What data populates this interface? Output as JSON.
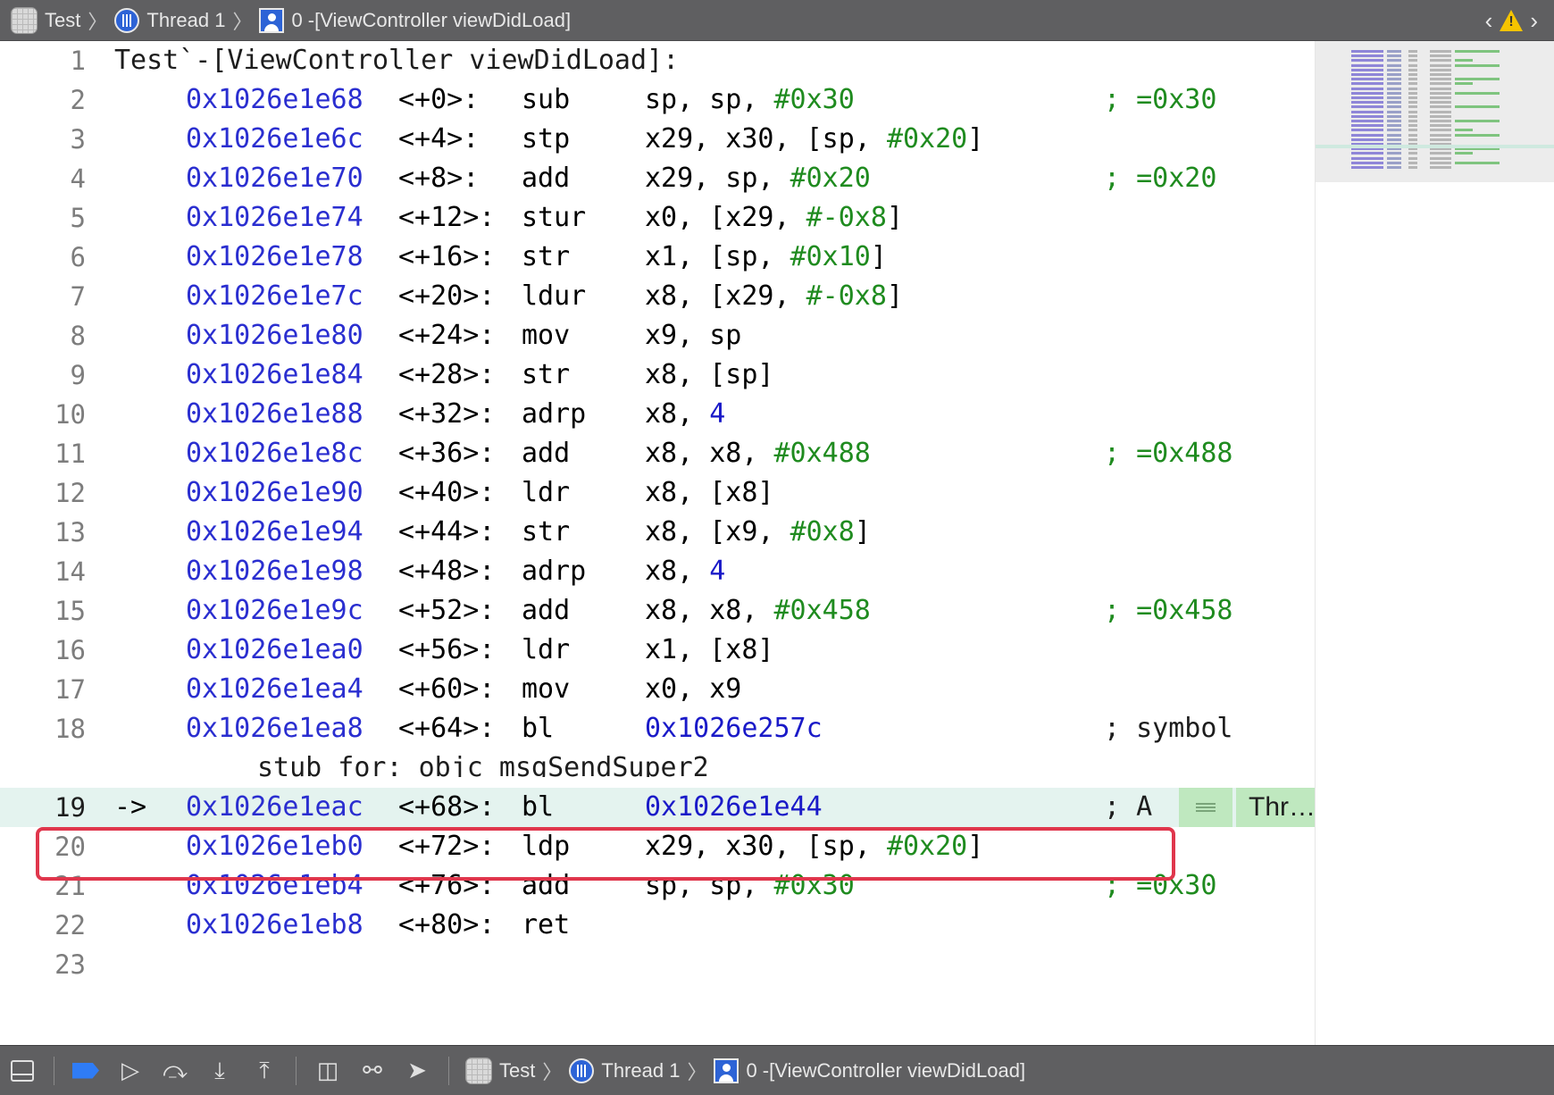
{
  "jump_bar": {
    "items": [
      {
        "label": "Test",
        "icon": "app-target-icon"
      },
      {
        "label": "Thread 1",
        "icon": "thread-icon"
      },
      {
        "label": "0 -[ViewController viewDidLoad]",
        "icon": "stack-frame-icon"
      }
    ],
    "separator": "〉"
  },
  "nav": {
    "back": "‹",
    "forward": "›",
    "warning_icon": "warning-icon",
    "warning_color": "#f5c400"
  },
  "disassembly": {
    "header_line": {
      "n": "1",
      "text": "Test`-[ViewController viewDidLoad]:"
    },
    "lines": [
      {
        "n": "2",
        "addr": "0x1026e1e68",
        "off": "<+0>:",
        "op": "sub",
        "args": [
          [
            "sp, sp, ",
            "t"
          ],
          [
            "#0x30",
            "imm"
          ]
        ],
        "cmt": "; =0x30"
      },
      {
        "n": "3",
        "addr": "0x1026e1e6c",
        "off": "<+4>:",
        "op": "stp",
        "args": [
          [
            "x29, x30, [sp, ",
            "t"
          ],
          [
            "#0x20",
            "imm"
          ],
          [
            "]",
            "t"
          ]
        ],
        "cmt": ""
      },
      {
        "n": "4",
        "addr": "0x1026e1e70",
        "off": "<+8>:",
        "op": "add",
        "args": [
          [
            "x29, sp, ",
            "t"
          ],
          [
            "#0x20",
            "imm"
          ]
        ],
        "cmt": "; =0x20"
      },
      {
        "n": "5",
        "addr": "0x1026e1e74",
        "off": "<+12>:",
        "op": "stur",
        "args": [
          [
            "x0, [x29, ",
            "t"
          ],
          [
            "#-0x8",
            "imm"
          ],
          [
            "]",
            "t"
          ]
        ],
        "cmt": ""
      },
      {
        "n": "6",
        "addr": "0x1026e1e78",
        "off": "<+16>:",
        "op": "str",
        "args": [
          [
            "x1, [sp, ",
            "t"
          ],
          [
            "#0x10",
            "imm"
          ],
          [
            "]",
            "t"
          ]
        ],
        "cmt": ""
      },
      {
        "n": "7",
        "addr": "0x1026e1e7c",
        "off": "<+20>:",
        "op": "ldur",
        "args": [
          [
            "x8, [x29, ",
            "t"
          ],
          [
            "#-0x8",
            "imm"
          ],
          [
            "]",
            "t"
          ]
        ],
        "cmt": ""
      },
      {
        "n": "8",
        "addr": "0x1026e1e80",
        "off": "<+24>:",
        "op": "mov",
        "args": [
          [
            "x9, sp",
            "t"
          ]
        ],
        "cmt": ""
      },
      {
        "n": "9",
        "addr": "0x1026e1e84",
        "off": "<+28>:",
        "op": "str",
        "args": [
          [
            "x8, [sp]",
            "t"
          ]
        ],
        "cmt": ""
      },
      {
        "n": "10",
        "addr": "0x1026e1e88",
        "off": "<+32>:",
        "op": "adrp",
        "args": [
          [
            "x8, ",
            "t"
          ],
          [
            "4",
            "num"
          ]
        ],
        "cmt": ""
      },
      {
        "n": "11",
        "addr": "0x1026e1e8c",
        "off": "<+36>:",
        "op": "add",
        "args": [
          [
            "x8, x8, ",
            "t"
          ],
          [
            "#0x488",
            "imm"
          ]
        ],
        "cmt": "; =0x488"
      },
      {
        "n": "12",
        "addr": "0x1026e1e90",
        "off": "<+40>:",
        "op": "ldr",
        "args": [
          [
            "x8, [x8]",
            "t"
          ]
        ],
        "cmt": ""
      },
      {
        "n": "13",
        "addr": "0x1026e1e94",
        "off": "<+44>:",
        "op": "str",
        "args": [
          [
            "x8, [x9, ",
            "t"
          ],
          [
            "#0x8",
            "imm"
          ],
          [
            "]",
            "t"
          ]
        ],
        "cmt": ""
      },
      {
        "n": "14",
        "addr": "0x1026e1e98",
        "off": "<+48>:",
        "op": "adrp",
        "args": [
          [
            "x8, ",
            "t"
          ],
          [
            "4",
            "num"
          ]
        ],
        "cmt": ""
      },
      {
        "n": "15",
        "addr": "0x1026e1e9c",
        "off": "<+52>:",
        "op": "add",
        "args": [
          [
            "x8, x8, ",
            "t"
          ],
          [
            "#0x458",
            "imm"
          ]
        ],
        "cmt": "; =0x458"
      },
      {
        "n": "16",
        "addr": "0x1026e1ea0",
        "off": "<+56>:",
        "op": "ldr",
        "args": [
          [
            "x1, [x8]",
            "t"
          ]
        ],
        "cmt": ""
      },
      {
        "n": "17",
        "addr": "0x1026e1ea4",
        "off": "<+60>:",
        "op": "mov",
        "args": [
          [
            "x0, x9",
            "t"
          ]
        ],
        "cmt": ""
      },
      {
        "n": "18",
        "addr": "0x1026e1ea8",
        "off": "<+64>:",
        "op": "bl",
        "args": [
          [
            "0x1026e257c",
            "num"
          ]
        ],
        "cmt": "; symbol",
        "cmt_plain": true,
        "wrap": "stub for: objc_msgSendSuper2"
      },
      {
        "n": "19",
        "addr": "0x1026e1eac",
        "off": "<+68>:",
        "op": "bl",
        "args": [
          [
            "0x1026e1e44",
            "num"
          ]
        ],
        "cmt": "; A",
        "cmt_plain": true,
        "current": true,
        "pc_marker": "->",
        "thread_badge": "Thr…"
      },
      {
        "n": "20",
        "addr": "0x1026e1eb0",
        "off": "<+72>:",
        "op": "ldp",
        "args": [
          [
            "x29, x30, [sp, ",
            "t"
          ],
          [
            "#0x20",
            "imm"
          ],
          [
            "]",
            "t"
          ]
        ],
        "cmt": ""
      },
      {
        "n": "21",
        "addr": "0x1026e1eb4",
        "off": "<+76>:",
        "op": "add",
        "args": [
          [
            "sp, sp, ",
            "t"
          ],
          [
            "#0x30",
            "imm"
          ]
        ],
        "cmt": "; =0x30"
      },
      {
        "n": "22",
        "addr": "0x1026e1eb8",
        "off": "<+80>:",
        "op": "ret",
        "args": [],
        "cmt": ""
      }
    ],
    "trailing_line": {
      "n": "23"
    }
  },
  "colors": {
    "address": "#2a2ed0",
    "immediate": "#1f8b1f",
    "number": "#1a1ac8",
    "current_line_bg": "#e4f3ef",
    "highlight_box": "#e0364c",
    "thread_badge_bg": "#bfe8bf"
  },
  "debug_bar": {
    "tools": [
      {
        "name": "hide-debug-area-button",
        "icon": "panel-icon"
      },
      {
        "name": "breakpoints-toggle-button",
        "icon": "breakpoint-icon"
      },
      {
        "name": "continue-button",
        "icon": "continue-icon"
      },
      {
        "name": "step-over-button",
        "icon": "step-over-icon"
      },
      {
        "name": "step-into-button",
        "icon": "step-into-icon"
      },
      {
        "name": "step-out-button",
        "icon": "step-out-icon"
      },
      {
        "name": "view-debugger-button",
        "icon": "view-hierarchy-icon"
      },
      {
        "name": "memory-graph-button",
        "icon": "memory-graph-icon"
      },
      {
        "name": "simulate-location-button",
        "icon": "location-icon"
      }
    ],
    "breadcrumbs": [
      {
        "label": "Test",
        "icon": "app-target-icon"
      },
      {
        "label": "Thread 1",
        "icon": "thread-icon"
      },
      {
        "label": "0 -[ViewController viewDidLoad]",
        "icon": "stack-frame-icon"
      }
    ]
  }
}
